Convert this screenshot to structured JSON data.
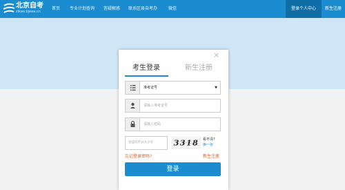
{
  "brand": {
    "title": "北京自考",
    "subtitle": "zikao.bjeea.cn"
  },
  "nav": {
    "items": [
      "首页",
      "专业计划查询",
      "答疑解惑",
      "联系区县自考办",
      "微信"
    ],
    "login_center": "登录个人中心",
    "new_register": "新生注册"
  },
  "modal": {
    "close": "×",
    "tabs": {
      "login": "考生登录",
      "register": "新生注册"
    },
    "id_type": {
      "selected": "准考证号",
      "icon": "list-icon"
    },
    "candidate_number": {
      "placeholder": "请输入准考证号",
      "icon": "user-icon"
    },
    "password": {
      "placeholder": "请输入密码",
      "icon": "lock-icon"
    },
    "captcha": {
      "placeholder": "验证码不分大小写",
      "code": "3318",
      "cant_see": "看不清?",
      "change": "换一张"
    },
    "forgot": "忘记登录密码?",
    "register_link": "新生注册",
    "submit": "登录"
  },
  "colors": {
    "accent": "#1a8ccf",
    "accent_dark": "#0f6ea6",
    "link_orange": "#e25a1c",
    "hero": "#cfe6f6"
  }
}
